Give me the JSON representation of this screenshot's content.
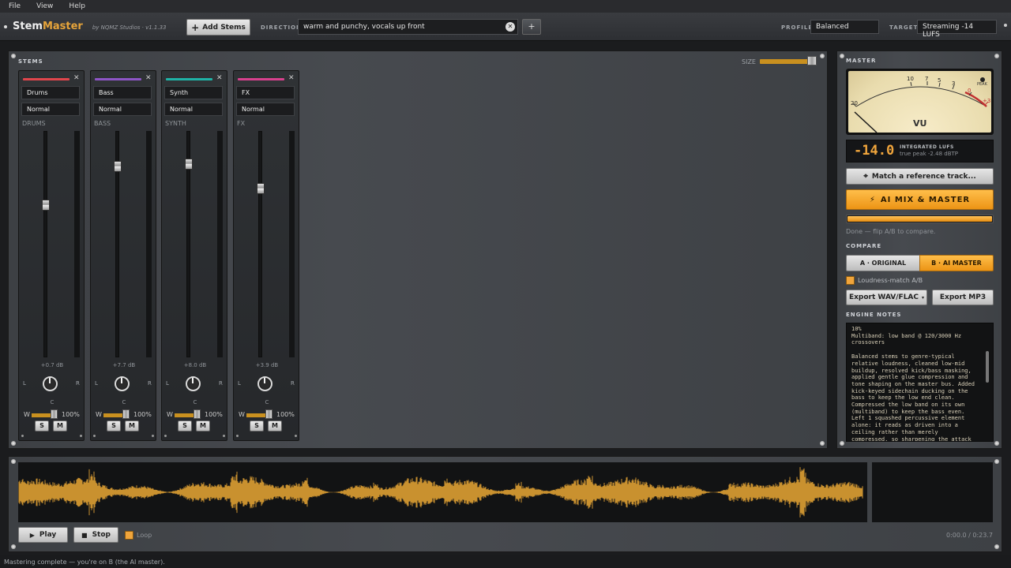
{
  "menu": [
    "File",
    "View",
    "Help"
  ],
  "brand": {
    "name_a": "Stem",
    "name_b": "Master",
    "byline": "by NQMZ Studios  ·  v1.1.33"
  },
  "toolbar": {
    "add_stems": "Add Stems",
    "direction_label": "DIRECTION",
    "direction_value": "warm and punchy, vocals up front",
    "add_direction": "+",
    "profile_label": "PROFILE",
    "profile_value": "Balanced",
    "target_label": "TARGET",
    "target_value": "Streaming -14 LUFS"
  },
  "stems": {
    "title": "STEMS",
    "size_label": "SIZE",
    "size_level": 0.85,
    "strips": [
      {
        "name": "Drums",
        "mode": "Normal",
        "label": "DRUMS",
        "color": "#e0464c",
        "gain": "+0.7 dB",
        "fader": 0.32,
        "pan": "C",
        "width": "100%",
        "solo": "S",
        "mute": "M"
      },
      {
        "name": "Bass",
        "mode": "Normal",
        "label": "BASS",
        "color": "#8e55c6",
        "gain": "+7.7 dB",
        "fader": 0.14,
        "pan": "C",
        "width": "100%",
        "solo": "S",
        "mute": "M"
      },
      {
        "name": "Synth",
        "mode": "Normal",
        "label": "SYNTH",
        "color": "#1fb3a6",
        "gain": "+8.0 dB",
        "fader": 0.13,
        "pan": "C",
        "width": "100%",
        "solo": "S",
        "mute": "M"
      },
      {
        "name": "FX",
        "mode": "Normal",
        "label": "FX",
        "color": "#d8418e",
        "gain": "+3.9 dB",
        "fader": 0.24,
        "pan": "C",
        "width": "100%",
        "solo": "S",
        "mute": "M"
      }
    ],
    "pan_left": "L",
    "pan_right": "R",
    "width_label": "W"
  },
  "master": {
    "title": "MASTER",
    "vu_label": "VU",
    "vu_ticks": [
      "20",
      "10",
      "7",
      "5",
      "3",
      "0",
      "+3"
    ],
    "peak_label": "PEAK",
    "lufs_value": "-14.0",
    "lufs_label": "INTEGRATED LUFS",
    "true_peak": "true peak  -2.48 dBTP",
    "match_ref": "Match a reference track...",
    "ai_button": "AI  MIX & MASTER",
    "progress": 1.0,
    "status": "Done — flip A/B to compare.",
    "compare_title": "COMPARE",
    "compare_a": "A · ORIGINAL",
    "compare_b": "B · AI MASTER",
    "loudness_match": "Loudness-match A/B",
    "export_wav": "Export WAV/FLAC",
    "export_mp3": "Export MP3",
    "notes_title": "ENGINE NOTES",
    "notes_1": "10%\nMultiband: low band @ 120/3000 Hz\ncrossovers",
    "notes_2": "Balanced stems to genre-typical\nrelative loudness, cleaned low-mid\nbuildup, resolved kick/bass masking,\napplied gentle glue compression and\ntone shaping on the master bus. Added\nkick-keyed sidechain ducking on the\nbass to keep the low end clean.\nCompressed the low band on its own\n(multiband) to keep the bass even.\nLeft 1 squashed percussive element\nalone: it reads as driven into a\nceiling rather than merely\ncompressed, so sharpening the attack"
  },
  "transport": {
    "play": "Play",
    "stop": "Stop",
    "loop": "Loop",
    "time": "0:00.0 / 0:23.7"
  },
  "status_bar": "Mastering complete — you're on B (the AI master).",
  "colors": {
    "accent": "#f0a53c",
    "wave": "#c9912f"
  }
}
